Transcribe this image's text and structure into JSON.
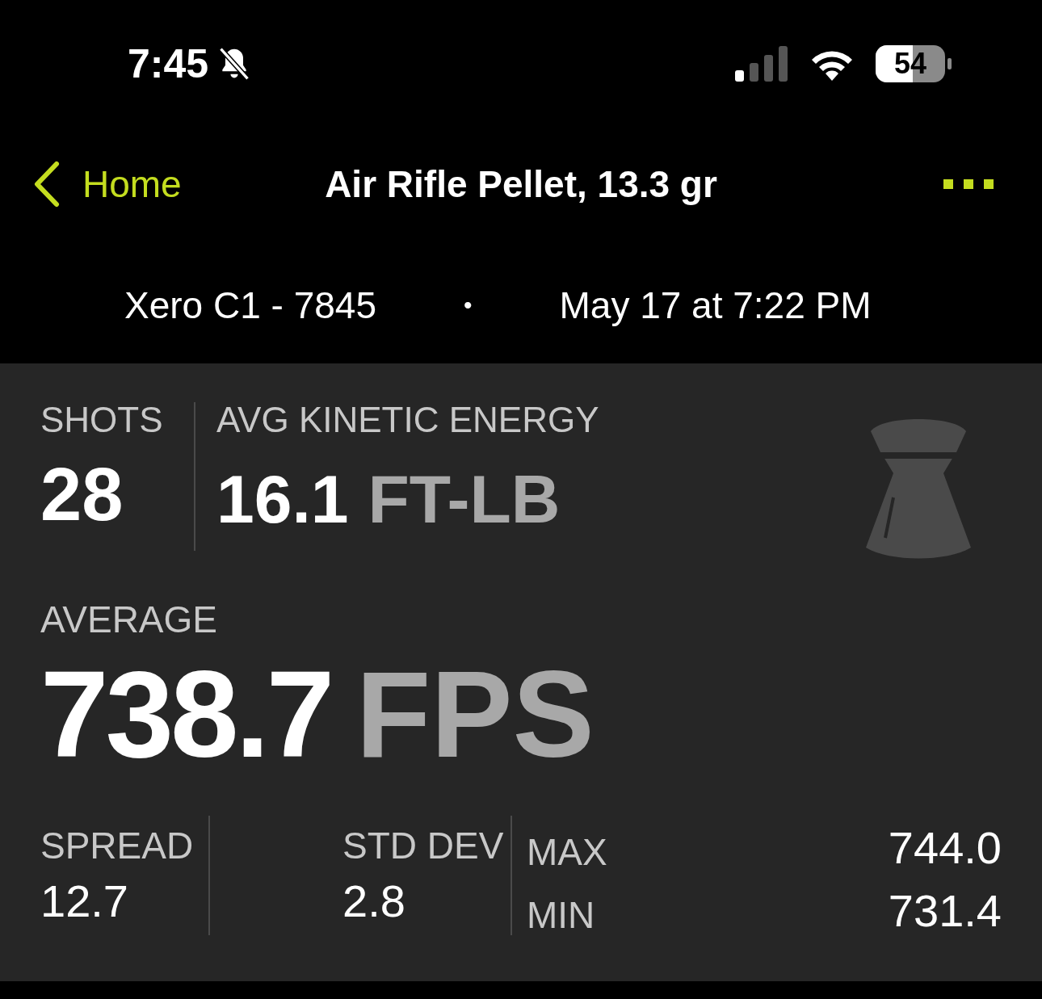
{
  "status_bar": {
    "time": "7:45",
    "battery": "54",
    "silent": true
  },
  "nav": {
    "back_label": "Home",
    "title": "Air Rifle Pellet, 13.3 gr"
  },
  "session": {
    "device": "Xero C1 - 7845",
    "separator": "•",
    "date": "May 17 at 7:22 PM"
  },
  "summary": {
    "shots_label": "SHOTS",
    "shots": "28",
    "energy_label": "AVG KINETIC ENERGY",
    "energy_value": "16.1",
    "energy_unit": "FT-LB"
  },
  "average": {
    "label": "AVERAGE",
    "value": "738.7",
    "unit": "FPS"
  },
  "details": [
    {
      "label": "SPREAD",
      "value": "12.7"
    },
    {
      "label": "STD DEV",
      "value": "2.8"
    }
  ],
  "extremes": [
    {
      "label": "MAX",
      "value": "744.0"
    },
    {
      "label": "MIN",
      "value": "731.4"
    }
  ]
}
